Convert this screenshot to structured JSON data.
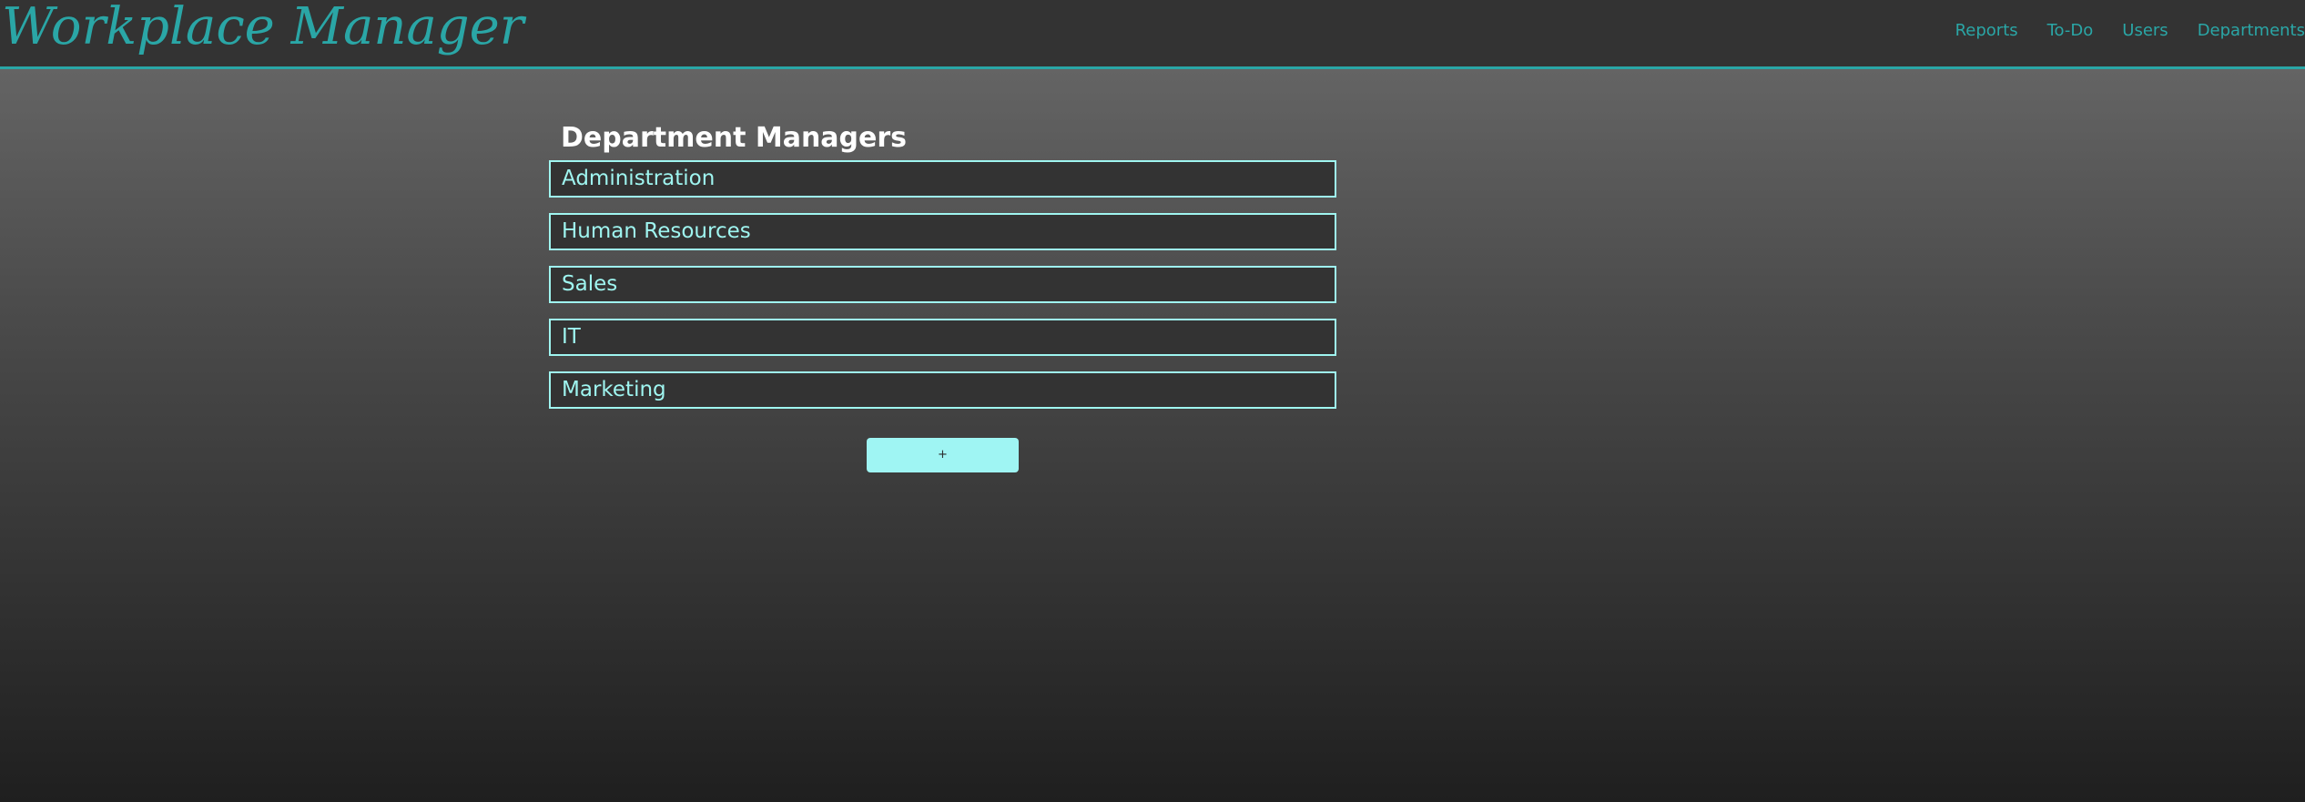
{
  "app": {
    "title": "Workplace Manager"
  },
  "nav": {
    "items": [
      {
        "label": "Reports"
      },
      {
        "label": "To-Do"
      },
      {
        "label": "Users"
      },
      {
        "label": "Departments"
      }
    ]
  },
  "main": {
    "heading": "Department Managers",
    "departments": [
      {
        "label": "Administration"
      },
      {
        "label": "Human Resources"
      },
      {
        "label": "Sales"
      },
      {
        "label": "IT"
      },
      {
        "label": "Marketing"
      }
    ],
    "add_button_label": "+"
  },
  "colors": {
    "accent": "#2aa6a6",
    "item_text": "#9ff5f0",
    "item_bg": "#333333",
    "topbar_bg": "#333333",
    "button_bg": "#9ff5f3"
  }
}
